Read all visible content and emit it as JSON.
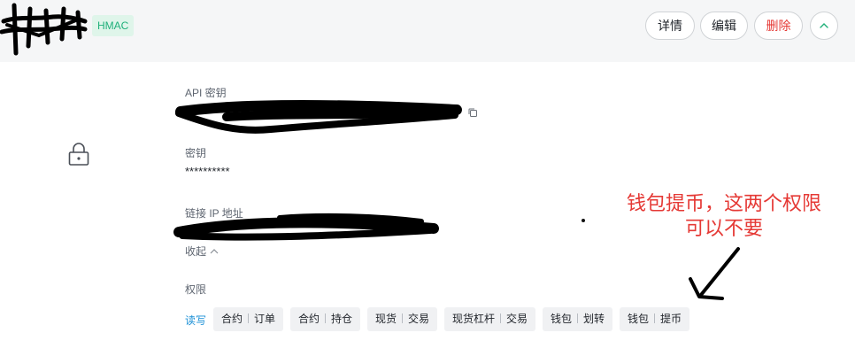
{
  "header": {
    "badge": "HMAC",
    "buttons": {
      "detail": "详情",
      "edit": "编辑",
      "delete": "删除"
    }
  },
  "fields": {
    "api_key_label": "API 密钥",
    "secret_label": "密钥",
    "secret_value": "**********",
    "ip_label": "链接 IP 地址",
    "collapse_label": "收起"
  },
  "permissions": {
    "label": "权限",
    "mode": "读写",
    "tags": [
      {
        "a": "合约",
        "b": "订单"
      },
      {
        "a": "合约",
        "b": "持仓"
      },
      {
        "a": "现货",
        "b": "交易"
      },
      {
        "a": "现货杠杆",
        "b": "交易"
      },
      {
        "a": "钱包",
        "b": "划转"
      },
      {
        "a": "钱包",
        "b": "提币"
      }
    ]
  },
  "annotation": {
    "line1": "钱包提币，这两个权限",
    "line2": "可以不要"
  }
}
